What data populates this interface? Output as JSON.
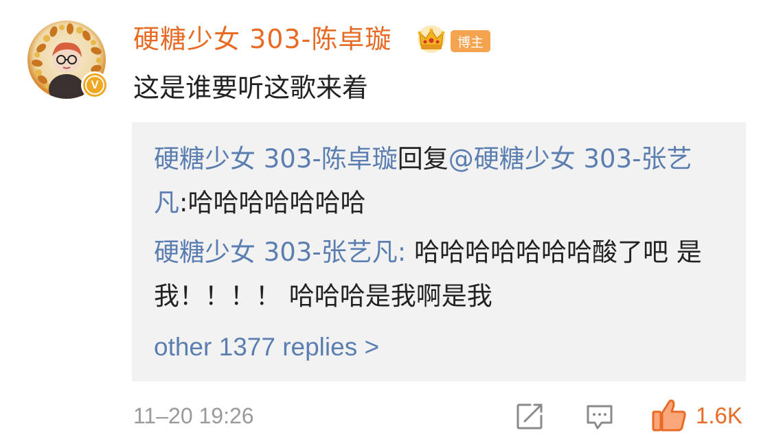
{
  "post": {
    "username": "硬糖少女 303-陈卓璇",
    "badge_label": "博主",
    "verified_mark": "V",
    "comment_text": "这是谁要听这歌来着",
    "timestamp": "11–20 19:26",
    "like_count": "1.6K",
    "colors": {
      "username": "#e86b25",
      "link": "#5b7eb1",
      "badge_bg": "#f4a34e",
      "verified_bg": "#f0a722",
      "reply_box_bg": "#f2f2f2"
    },
    "icons": [
      "crown-icon",
      "share-icon",
      "comment-icon",
      "like-icon",
      "verified-icon"
    ]
  },
  "replies": [
    {
      "author": "硬糖少女 303-陈卓璇",
      "connector": "回复",
      "mention": "@硬糖少女 303-张艺凡",
      "text": ":哈哈哈哈哈哈哈"
    },
    {
      "author": "硬糖少女 303-张艺凡",
      "separator": ": ",
      "text": "哈哈哈哈哈哈哈酸了吧 是我！！！！ 哈哈哈是我啊是我"
    }
  ],
  "more_replies_label": "other 1377 replies >"
}
